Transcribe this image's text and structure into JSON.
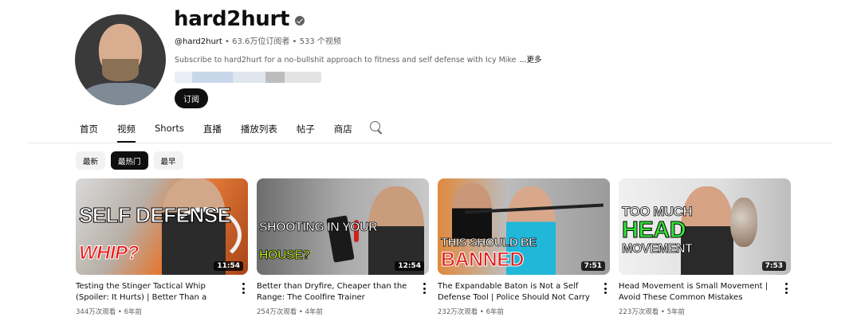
{
  "channel": {
    "name": "hard2hurt",
    "handle": "@hard2hurt",
    "stats": " • 63.6万位订阅者 • 533 个视频",
    "description": "Subscribe to hard2hurt for a no-bullshit approach to fitness and self defense with Icy Mike",
    "more_label": "...更多",
    "subscribe_label": "订阅"
  },
  "tabs": [
    {
      "label": "首页"
    },
    {
      "label": "视频"
    },
    {
      "label": "Shorts"
    },
    {
      "label": "直播"
    },
    {
      "label": "播放列表"
    },
    {
      "label": "帖子"
    },
    {
      "label": "商店"
    }
  ],
  "filters": [
    {
      "label": "最新"
    },
    {
      "label": "最热门"
    },
    {
      "label": "最早"
    }
  ],
  "videos": [
    {
      "title": "Testing the Stinger Tactical Whip (Spoiler: It Hurts) | Better Than a Baton?",
      "meta": "344万次观看 • 6年前",
      "duration": "11:54",
      "thumb_text": [
        "SELF DEFENSE",
        "WHIP?"
      ]
    },
    {
      "title": "Better than Dryfire, Cheaper than the Range: The Coolfire Trainer",
      "meta": "254万次观看 • 4年前",
      "duration": "12:54",
      "thumb_text": [
        "SHOOTING IN YOUR",
        "HOUSE?"
      ]
    },
    {
      "title": "The Expandable Baton is Not a Self Defense Tool | Police Should Not Carry Batons",
      "meta": "232万次观看 • 6年前",
      "duration": "7:51",
      "thumb_text": [
        "THIS SHOULD BE",
        "BANNED"
      ]
    },
    {
      "title": "Head Movement is Small Movement | Avoid These Common Mistakes",
      "meta": "223万次观看 • 5年前",
      "duration": "7:53",
      "thumb_text": [
        "TOO MUCH",
        "HEAD",
        "MOVEMENT"
      ]
    }
  ]
}
